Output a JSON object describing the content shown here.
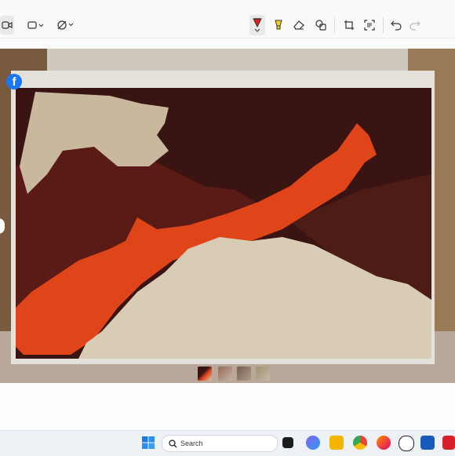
{
  "toolbar": {
    "tools": [
      "video-camera-icon",
      "rectangle-select-icon",
      "timer-icon",
      "pen-icon",
      "highlighter-icon",
      "eraser-icon",
      "shapes-icon",
      "crop-icon",
      "text-actions-icon",
      "undo-icon",
      "redo-icon"
    ]
  },
  "canvas": {
    "subject": "rug-photo",
    "colors": {
      "cream": "#d9ccb2",
      "dark_brown": "#3a1210",
      "maroon": "#5a1a16",
      "orange": "#e3461a",
      "brown": "#4a1e14",
      "border": "#e6e2dc"
    }
  },
  "overlay": {
    "facebook_icon": "facebook-icon",
    "thumbnails": 4
  },
  "taskbar": {
    "search_placeholder": "Search",
    "apps": [
      "windows-start-icon",
      "task-view-icon",
      "copilot-icon",
      "file-explorer-icon",
      "chrome-icon",
      "firefox-icon",
      "s-app-icon",
      "word-icon",
      "acrobat-icon"
    ]
  }
}
